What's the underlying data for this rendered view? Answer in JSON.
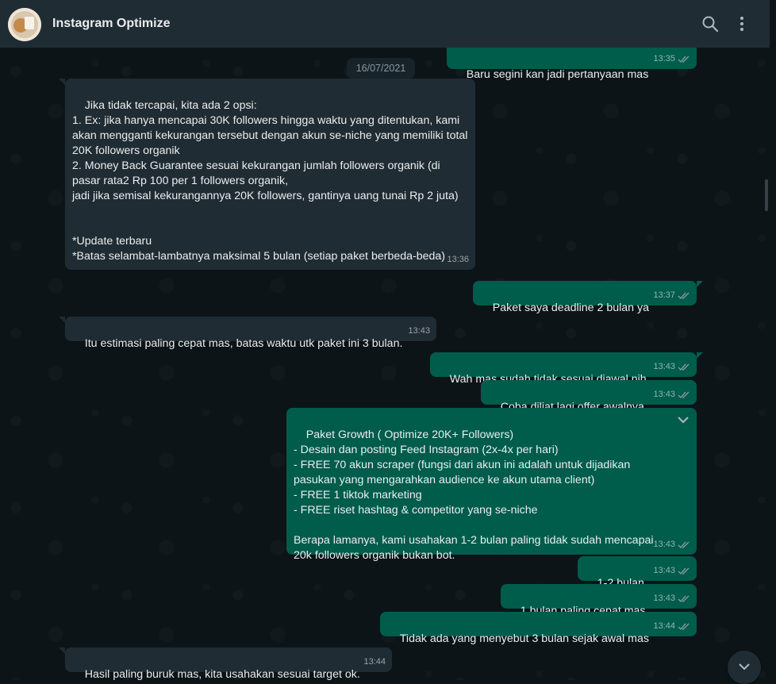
{
  "header": {
    "title": "Instagram Optimize",
    "icons": [
      "search-icon",
      "menu-icon"
    ]
  },
  "chat": {
    "date_separator": "16/07/2021",
    "messages": [
      {
        "direction": "out",
        "text": "Baru segini kan jadi pertanyaan mas",
        "time": "13:35",
        "read": true
      },
      {
        "direction": "in",
        "text": "Jika tidak tercapai, kita ada 2 opsi:\n1. Ex: jika hanya mencapai 30K followers hingga waktu yang ditentukan, kami akan mengganti kekurangan tersebut dengan akun se-niche yang memiliki total 20K followers organik\n2. Money Back Guarantee sesuai kekurangan jumlah followers organik (di pasar rata2 Rp 100 per 1 followers organik,\njadi jika semisal kekurangannya 20K followers, gantinya uang tunai Rp 2 juta)\n\n\n*Update terbaru\n*Batas selambat-lambatnya maksimal 5 bulan (setiap paket berbeda-beda)",
        "time": "13:36"
      },
      {
        "direction": "out",
        "text": "Paket saya deadline 2 bulan ya",
        "time": "13:37",
        "read": true
      },
      {
        "direction": "in",
        "text": "Itu estimasi paling cepat mas, batas waktu utk paket ini 3 bulan.",
        "time": "13:43"
      },
      {
        "direction": "out",
        "text": "Wah mas sudah tidak sesuai diawal nih.",
        "time": "13:43",
        "read": true
      },
      {
        "direction": "out",
        "text": "Coba diliat lagi offer awalnya",
        "time": "13:43",
        "read": true
      },
      {
        "direction": "out",
        "text": "Paket Growth ( Optimize 20K+ Followers)\n- Desain dan posting Feed Instagram (2x-4x per hari)\n- FREE 70 akun scraper (fungsi dari akun ini adalah untuk dijadikan pasukan yang mengarahkan audience ke akun utama client)\n- FREE 1 tiktok marketing\n- FREE riset hashtag & competitor yang se-niche\n\nBerapa lamanya, kami usahakan 1-2 bulan paling tidak sudah mencapai 20k followers organik bukan bot.",
        "time": "13:43",
        "read": true
      },
      {
        "direction": "out",
        "text": "1-2 bulan",
        "time": "13:43",
        "read": true
      },
      {
        "direction": "out",
        "text": "1 bulan paling cepat mas",
        "time": "13:43",
        "read": true
      },
      {
        "direction": "out",
        "text": "Tidak ada yang menyebut 3 bulan sejak awal mas",
        "time": "13:44",
        "read": true
      },
      {
        "direction": "in",
        "text": "Hasil paling buruk mas, kita usahakan sesuai target ok.",
        "time": "13:44"
      }
    ]
  },
  "colors": {
    "header_bg": "#202c33",
    "chat_bg": "#0d1418",
    "incoming_bubble": "#202c33",
    "outgoing_bubble": "#005c4b",
    "read_ticks": "#8696a0"
  }
}
